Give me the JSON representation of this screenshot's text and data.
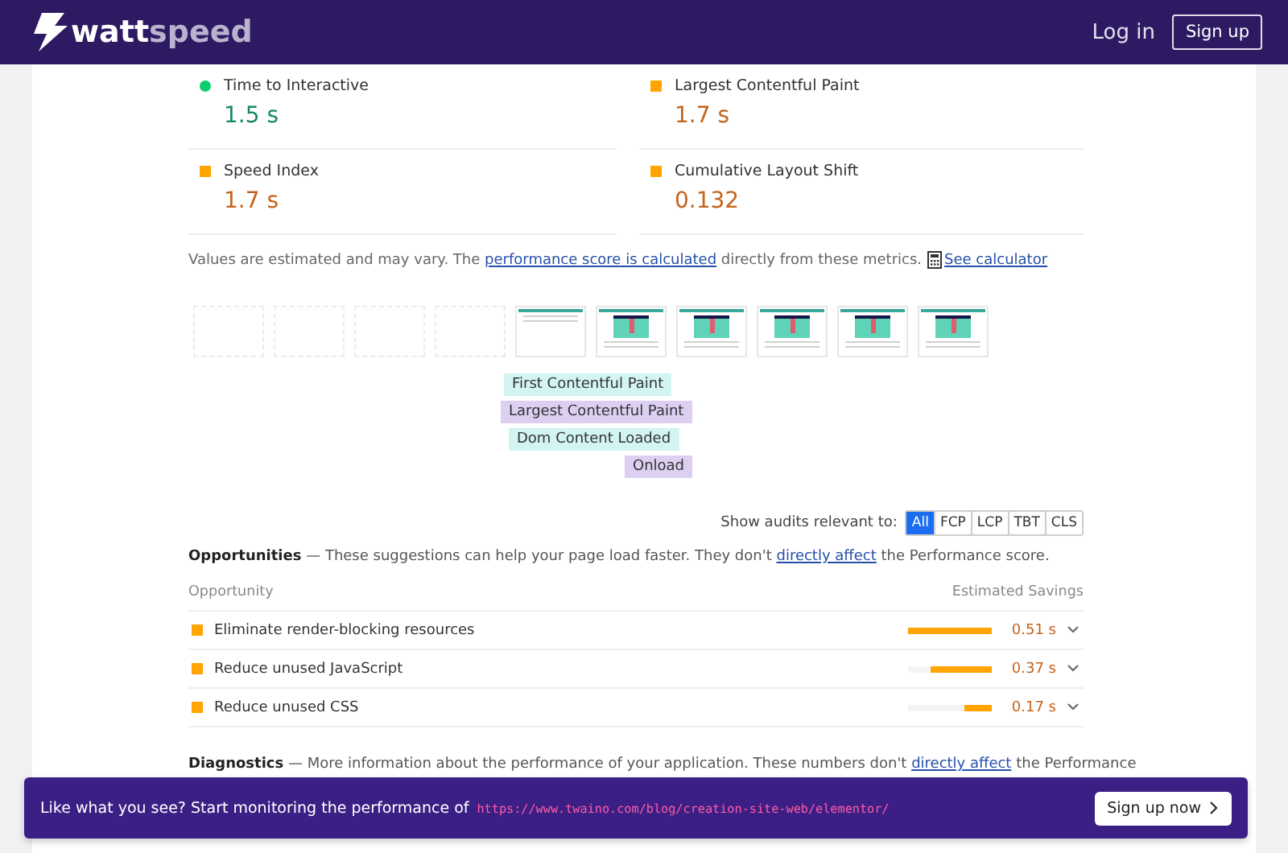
{
  "header": {
    "logo_bold": "watt",
    "logo_light": "speed",
    "login": "Log in",
    "signup": "Sign up"
  },
  "metrics": [
    {
      "label": "Time to Interactive",
      "value": "1.5 s",
      "kind": "dot",
      "color": "#0cce6b"
    },
    {
      "label": "Largest Contentful Paint",
      "value": "1.7 s",
      "kind": "square",
      "color": "#ffa400"
    },
    {
      "label": "Speed Index",
      "value": "1.7 s",
      "kind": "square",
      "color": "#ffa400"
    },
    {
      "label": "Cumulative Layout Shift",
      "value": "0.132",
      "kind": "square",
      "color": "#ffa400"
    }
  ],
  "note": {
    "before": "Values are estimated and may vary. The ",
    "link": "performance score is calculated",
    "after": " directly from these metrics.",
    "calculator": "See calculator"
  },
  "filmstrip": {
    "frames": [
      {
        "kind": "blank"
      },
      {
        "kind": "blank"
      },
      {
        "kind": "blank"
      },
      {
        "kind": "blank"
      },
      {
        "kind": "partial"
      },
      {
        "kind": "full"
      },
      {
        "kind": "full"
      },
      {
        "kind": "full"
      },
      {
        "kind": "full"
      },
      {
        "kind": "full"
      }
    ],
    "markers": [
      {
        "label": "First Contentful Paint",
        "kind": "paint"
      },
      {
        "label": "Largest Contentful Paint",
        "kind": "load"
      },
      {
        "label": "Dom Content Loaded",
        "kind": "paint"
      },
      {
        "label": "Onload",
        "kind": "load"
      }
    ]
  },
  "filter": {
    "label": "Show audits relevant to:",
    "options": [
      {
        "label": "All",
        "selected": true
      },
      {
        "label": "FCP",
        "selected": false
      },
      {
        "label": "LCP",
        "selected": false
      },
      {
        "label": "TBT",
        "selected": false
      },
      {
        "label": "CLS",
        "selected": false
      }
    ]
  },
  "opportunities": {
    "title": "Opportunities",
    "intro": " — These suggestions can help your page load faster. They don't ",
    "link": "directly affect",
    "outro": " the Performance score.",
    "col_1": "Opportunity",
    "col_2": "Estimated Savings",
    "rows": [
      {
        "label": "Eliminate render-blocking resources",
        "level": 1,
        "saving": "0.51 s"
      },
      {
        "label": "Reduce unused JavaScript",
        "level": 0.74,
        "saving": "0.37 s"
      },
      {
        "label": "Reduce unused CSS",
        "level": 0.33,
        "saving": "0.17 s"
      }
    ]
  },
  "diagnostics": {
    "title": "Diagnostics",
    "intro": " — More information about the performance of your application. These numbers don't ",
    "link": "directly affect",
    "outro": " the Performance"
  },
  "banner": {
    "text": "Like what you see? Start monitoring the performance of",
    "url": "https://www.twaino.com/blog/creation-site-web/elementor/",
    "button": "Sign up now"
  }
}
